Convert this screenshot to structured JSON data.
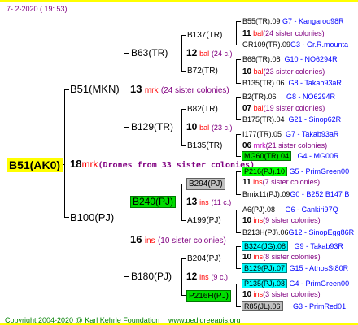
{
  "header": "7-   2-2020  ( 19:  53)",
  "footer": {
    "copyright": "Copyright 2004-2020 @ Karl Kehrle Foundation",
    "url": "www.pedigreeapis.org"
  },
  "root": {
    "name": "B51(AK0)",
    "num": "18",
    "code": "mrk",
    "note": "(Drones from 33 sister colonies)"
  },
  "sire": {
    "name": "B51(MKN)",
    "num": "13",
    "code": "mrk",
    "note": "(24 sister colonies)"
  },
  "dam": {
    "name": "B100(PJ)",
    "num": "16",
    "code": "ins",
    "note": "(10 sister colonies)"
  },
  "g2": {
    "b63": {
      "name": "B63(TR)",
      "num": "12",
      "code": "bal",
      "note": "(24 c.)"
    },
    "b129": {
      "name": "B129(TR)",
      "num": "10",
      "code": "bal",
      "note": "(23 c.)"
    },
    "b240": {
      "name": "B240(PJ)",
      "num": "13",
      "code": "ins",
      "note": "(11 c.)"
    },
    "b180": {
      "name": "B180(PJ)",
      "num": "12",
      "code": "ins",
      "note": "(9 c.)"
    }
  },
  "g3": {
    "b137": {
      "name": "B137(TR)",
      "num": "11",
      "code": "bal",
      "note": "(24 sister colonies)"
    },
    "b72": {
      "name": "B72(TR)",
      "num": "10",
      "code": "bal",
      "note": "(23 sister colonies)"
    },
    "b82": {
      "name": "B82(TR)",
      "num": "07",
      "code": "bal",
      "note": "(19 sister colonies)"
    },
    "b135": {
      "name": "B135(TR)",
      "num": "06",
      "code": "mrk",
      "note": "(21 sister colonies)"
    },
    "b294": {
      "name": "B294(PJ)",
      "num": "11",
      "code": "ins",
      "note": "(7 sister colonies)"
    },
    "a199": {
      "name": "A199(PJ)",
      "num": "10",
      "code": "ins",
      "note": "(9 sister colonies)"
    },
    "b204": {
      "name": "B204(PJ)",
      "num": "10",
      "code": "ins",
      "note": "(8 sister colonies)"
    },
    "p216": {
      "name": "P216H(PJ)",
      "num": "10",
      "code": "ins",
      "note": "(3 sister colonies)"
    }
  },
  "g4": [
    {
      "name": "B55(TR).09",
      "desc": "G7 - Kangaroo98R"
    },
    {
      "name": "GR109(TR).09",
      "desc": "G3 - Gr.R.mounta"
    },
    {
      "name": "B68(TR).08",
      "desc": "G10 - NO6294R"
    },
    {
      "name": "B135(TR).06",
      "desc": "G8 - Takab93aR"
    },
    {
      "name": "B2(TR).06",
      "desc": "G8 - NO6294R"
    },
    {
      "name": "B175(TR).04",
      "desc": "G21 - Sinop62R"
    },
    {
      "name": "I177(TR).05",
      "desc": "G7 - Takab93aR"
    },
    {
      "name": "MG60(TR).04",
      "desc": "G4 - MG00R"
    },
    {
      "name": "P216(PJ).10",
      "desc": "G5 - PrimGreen00"
    },
    {
      "name": "Bmix11(PJ).09",
      "desc": "G0 - B252 B147 B"
    },
    {
      "name": "A6(PJ).08",
      "desc": "G6 - Cankiri97Q"
    },
    {
      "name": "B213H(PJ).06",
      "desc": "G12 - SinopEgg86R"
    },
    {
      "name": "B324(JG).08",
      "desc": "G9 - Takab93R"
    },
    {
      "name": "B129(PJ).07",
      "desc": "G15 - AthosSt80R"
    },
    {
      "name": "P135(PJ).08",
      "desc": "G4 - PrimGreen00"
    },
    {
      "name": "R85(JL).06",
      "desc": "G3 - PrimRed01"
    }
  ]
}
